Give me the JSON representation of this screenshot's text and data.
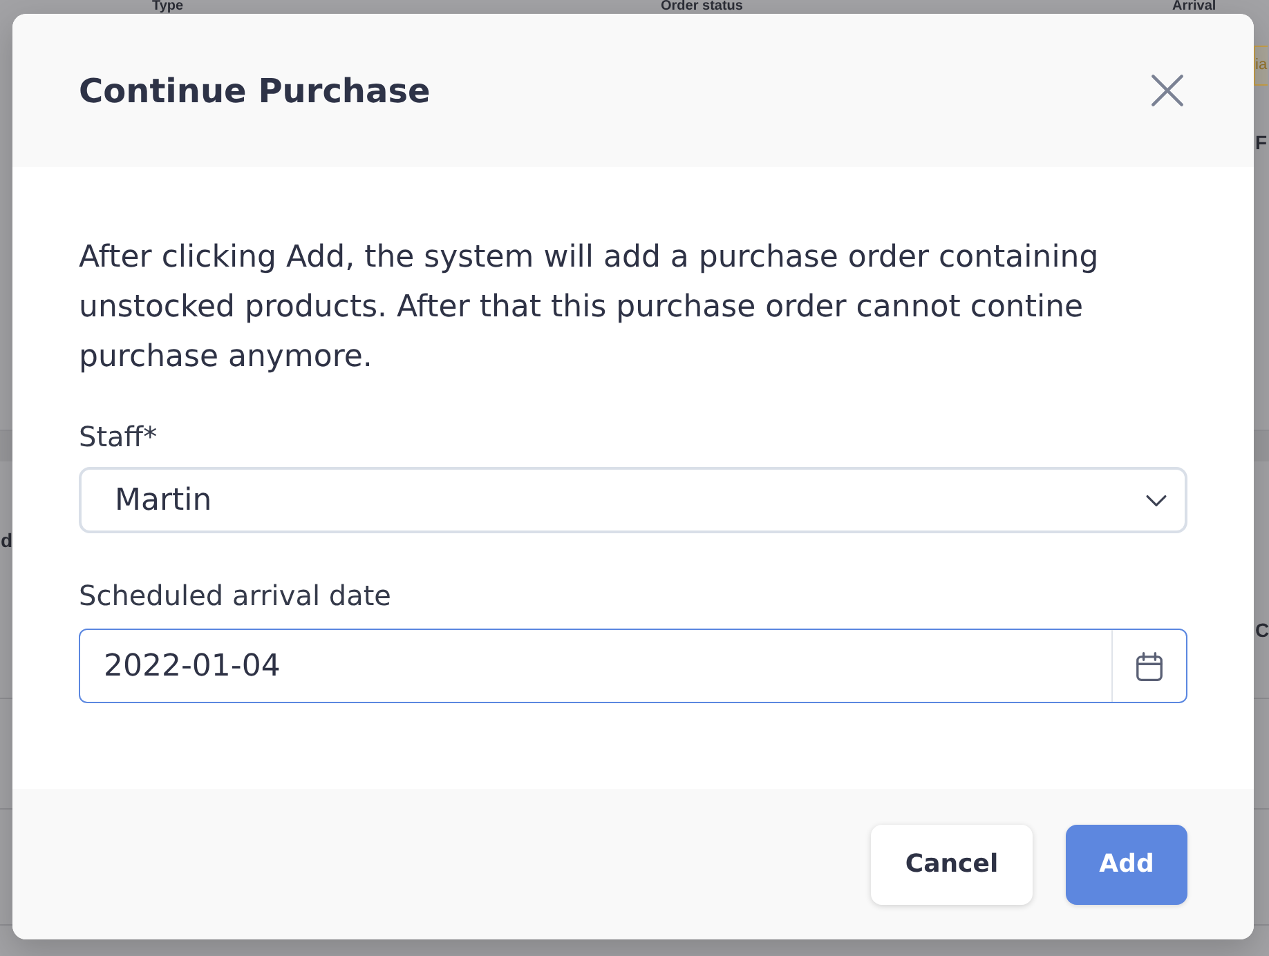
{
  "background": {
    "columns": [
      "Type",
      "Order status",
      "Arrival"
    ],
    "rows": [
      {
        "right_tag": "ia",
        "right_text": "F"
      },
      {
        "left_text": "d",
        "right_text": "C"
      }
    ]
  },
  "dialog": {
    "title": "Continue Purchase",
    "message": "After clicking Add, the system will add a purchase order containing unstocked products. After that this purchase order cannot contine purchase anymore.",
    "fields": [
      {
        "kind": "select",
        "label": "Staff*",
        "value": "Martin",
        "focused": false
      },
      {
        "kind": "date",
        "label": "Scheduled arrival date",
        "value": "2022-01-04",
        "focused": true
      }
    ],
    "buttons": [
      {
        "kind": "secondary",
        "label": "Cancel"
      },
      {
        "kind": "primary",
        "label": "Add"
      }
    ]
  }
}
